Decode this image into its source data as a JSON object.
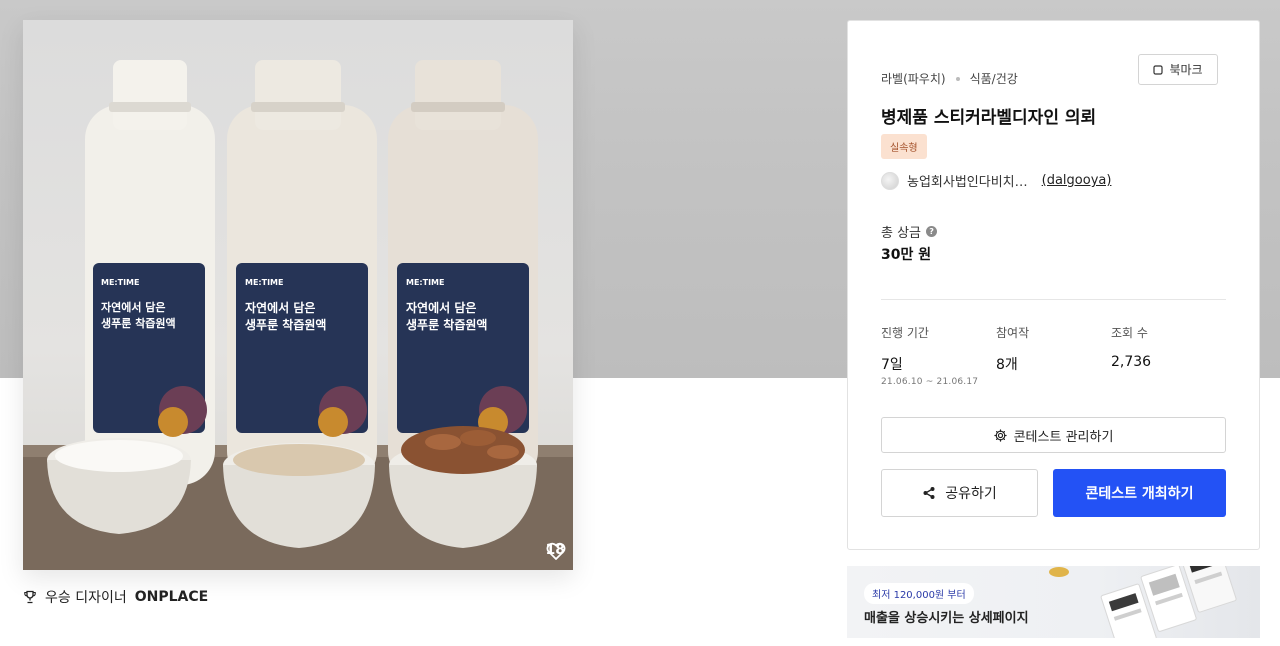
{
  "product": {
    "likes": "18",
    "winner_prefix": "우승 디자이너",
    "winner_name": "ONPLACE",
    "bottle_brand": "ME:TIME",
    "bottle_line1": "자연에서 담은",
    "bottle_line2": "생푸룬 착즙원액"
  },
  "contest": {
    "category_1": "라벨(파우치)",
    "category_2": "식품/건강",
    "bookmark_label": "북마크",
    "title": "병제품 스티커라벨디자인 의뢰",
    "badge": "실속형",
    "host_name": "농업회사법인다비치…",
    "host_id": "(dalgooya)",
    "prize_label": "총 상금",
    "prize_value": "30만 원",
    "stats": [
      {
        "label": "진행 기간",
        "value": "7일",
        "sub": "21.06.10 ~ 21.06.17"
      },
      {
        "label": "참여작",
        "value": "8개",
        "sub": ""
      },
      {
        "label": "조회 수",
        "value": "2,736",
        "sub": ""
      }
    ],
    "manage_label": "콘테스트 관리하기",
    "share_label": "공유하기",
    "host_contest_label": "콘테스트 개최하기"
  },
  "ad": {
    "pill": "최저 120,000원 부터",
    "text": "매출을 상승시키는 상세페이지"
  },
  "colors": {
    "primary": "#2352f5",
    "badge_bg": "#fbe1d0",
    "badge_text": "#a4522b",
    "label_navy": "#263456"
  }
}
